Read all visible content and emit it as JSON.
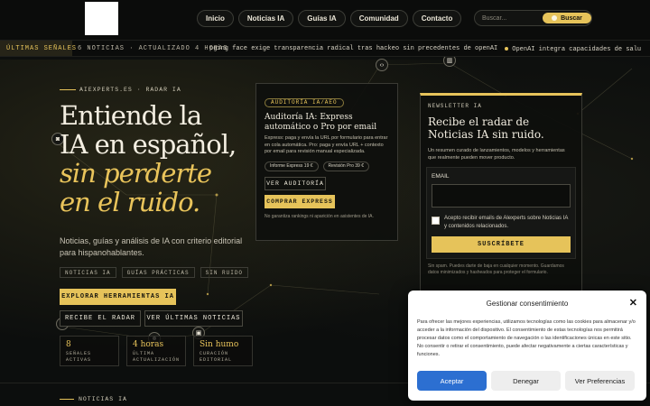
{
  "nav": {
    "items": [
      "Inicio",
      "Noticias IA",
      "Guías IA",
      "Comunidad",
      "Contacto"
    ],
    "search_placeholder": "Buscar...",
    "search_button": "Buscar"
  },
  "ticker": {
    "label": "ÚLTIMAS SEÑALES",
    "count": "6 NOTICIAS · ACTUALIZADO 4 HORAS",
    "items": [
      "pging face exige transparencia radical tras hackeo sin precedentes de openAI",
      "OpenAI integra capacidades de salu"
    ]
  },
  "hero": {
    "kicker": "AIEXPERTS.ES · RADAR IA",
    "title_lines": [
      "Entiende la",
      "IA en español,"
    ],
    "title_accent": [
      "sin perderte",
      "en el ruido."
    ],
    "lead": "Noticias, guías y análisis de IA con criterio editorial para hispanohablantes.",
    "chips": [
      "NOTICIAS IA",
      "GUÍAS PRÁCTICAS",
      "SIN RUIDO"
    ],
    "cta_primary": "EXPLORAR HERRAMIENTAS IA",
    "cta_radar": "RECIBE EL RADAR",
    "cta_news": "VER ÚLTIMAS NOTICIAS",
    "stats": [
      {
        "value": "8",
        "label": "SEÑALES ACTIVAS"
      },
      {
        "value": "4 horas",
        "label": "ÚLTIMA ACTUALIZACIÓN"
      },
      {
        "value": "Sin humo",
        "label": "CURACIÓN EDITORIAL"
      }
    ]
  },
  "audit": {
    "badge": "AUDITORÍA IA/AEO",
    "title": "Auditoría IA: Express automático o Pro por email",
    "desc": "Express: paga y envía la URL por formulario para entrar en cola automática. Pro: paga y envía URL + contexto por email para revisión manual especializada.",
    "pills": [
      "Informe Express 19 €",
      "Revisión Pro 39 €"
    ],
    "btn_view": "VER AUDITORÍA",
    "btn_buy": "COMPRAR EXPRESS",
    "note": "No garantiza rankings ni aparición en asistentes de IA."
  },
  "newsletter": {
    "tag": "NEWSLETTER IA",
    "title": "Recibe el radar de Noticias IA sin ruido.",
    "sub": "Un resumen curado de lanzamientos, modelos y herramientas que realmente pueden mover producto.",
    "email_label": "EMAIL",
    "consent": "Acepto recibir emails de Alexperts sobre Noticias IA y contenidos relacionados.",
    "subscribe": "SUSCRÍBETE",
    "fine": "Sin spam. Puedes darte de baja en cualquier momento. Guardamos datos minimizados y hasheados para proteger el formulario."
  },
  "bottom_label": "NOTICIAS IA",
  "cookie": {
    "title": "Gestionar consentimiento",
    "body": "Para ofrecer las mejores experiencias, utilizamos tecnologías como las cookies para almacenar y/o acceder a la información del dispositivo. El consentimiento de estas tecnologías nos permitirá procesar datos como el comportamiento de navegación o las identificaciones únicas en este sitio. No consentir o retirar el consentimiento, puede afectar negativamente a ciertas características y funciones.",
    "accept": "Aceptar",
    "deny": "Denegar",
    "prefs": "Ver Preferencias"
  },
  "colors": {
    "accent": "#e6c35a",
    "background": "#0d0f0e",
    "accept_button": "#2c6fd1"
  }
}
